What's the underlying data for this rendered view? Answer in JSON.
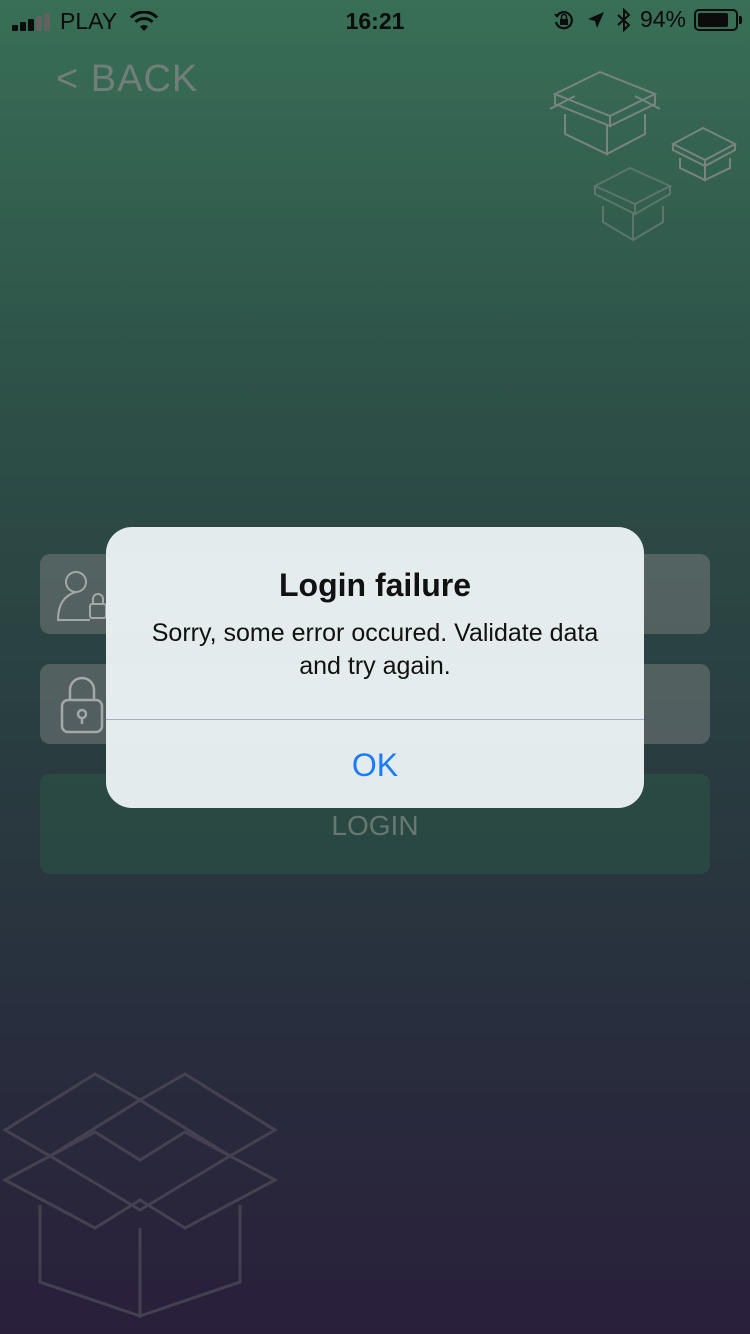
{
  "status_bar": {
    "carrier": "PLAY",
    "time": "16:21",
    "battery": "94%",
    "battery_level": 0.94,
    "signal_bars": 5,
    "signal_active": 3
  },
  "nav": {
    "back_label": "< BACK"
  },
  "form": {
    "login_label": "LOGIN"
  },
  "alert": {
    "title": "Login failure",
    "message": "Sorry, some error occured. Validate data and try again.",
    "ok_label": "OK"
  },
  "colors": {
    "accent": "#1a7cf6",
    "gradient_top": "#4f9a79",
    "gradient_bottom": "#3a2c52"
  },
  "icons": [
    "wifi-icon",
    "orientation-lock-icon",
    "location-arrow-icon",
    "bluetooth-icon",
    "battery-icon",
    "user-lock-icon",
    "padlock-icon",
    "box-icon"
  ]
}
